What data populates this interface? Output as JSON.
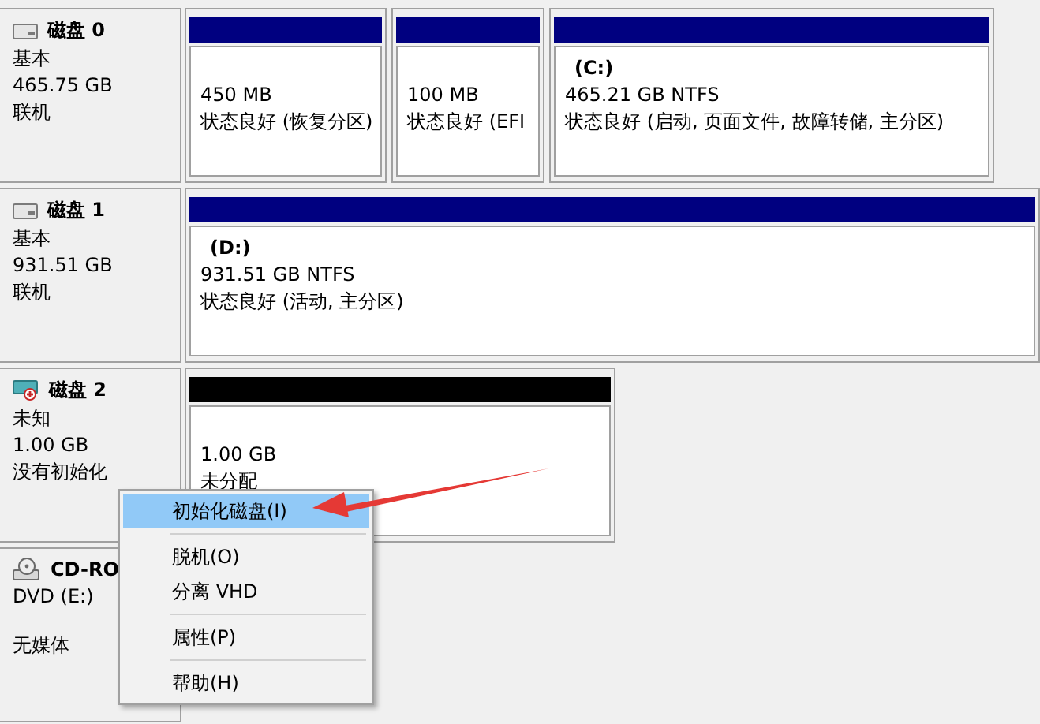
{
  "disks": [
    {
      "kind": "basic",
      "name": "磁盘 0",
      "type": "基本",
      "size": "465.75 GB",
      "status": "联机",
      "partitions": [
        {
          "kind": "primary",
          "size": "450 MB",
          "status": "状态良好 (恢复分区)"
        },
        {
          "kind": "primary",
          "size": "100 MB",
          "status": "状态良好 (EFI"
        },
        {
          "kind": "primary",
          "label": "(C:)",
          "size": "465.21 GB NTFS",
          "status": "状态良好 (启动, 页面文件, 故障转储, 主分区)"
        }
      ]
    },
    {
      "kind": "basic",
      "name": "磁盘 1",
      "type": "基本",
      "size": "931.51 GB",
      "status": "联机",
      "partitions": [
        {
          "kind": "primary",
          "label": "(D:)",
          "size": "931.51 GB NTFS",
          "status": "状态良好 (活动, 主分区)"
        }
      ]
    },
    {
      "kind": "unknown",
      "name": "磁盘 2",
      "type": "未知",
      "size": "1.00 GB",
      "status": "没有初始化",
      "partitions": [
        {
          "kind": "unallocated",
          "size": "1.00 GB",
          "status": "未分配"
        }
      ]
    },
    {
      "kind": "cdrom",
      "name": "CD-RO",
      "type": "DVD (E:)",
      "status": "无媒体"
    }
  ],
  "context_menu": [
    {
      "label": "初始化磁盘(I)",
      "selected": true,
      "separator_before": false
    },
    {
      "label": "脱机(O)",
      "selected": false,
      "separator_before": true
    },
    {
      "label": "分离 VHD",
      "selected": false,
      "separator_before": false
    },
    {
      "label": "属性(P)",
      "selected": false,
      "separator_before": true
    },
    {
      "label": "帮助(H)",
      "selected": false,
      "separator_before": true
    }
  ]
}
